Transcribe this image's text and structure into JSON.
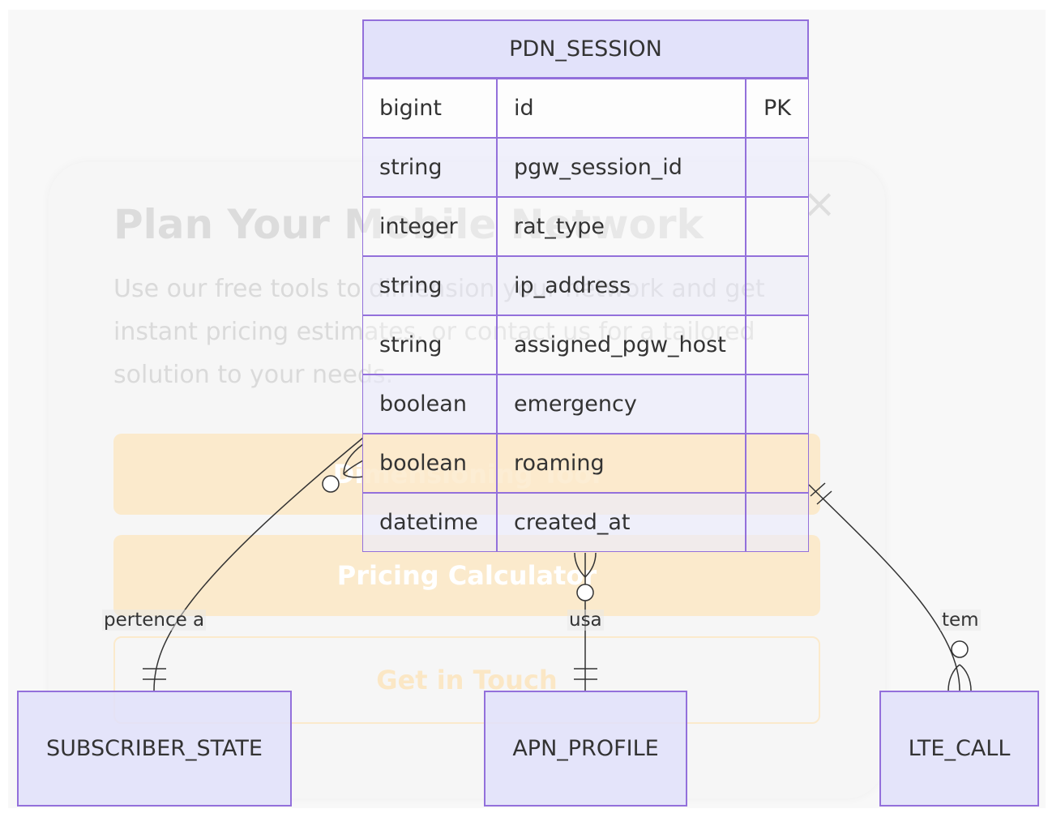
{
  "modal": {
    "title": "Plan Your Mobile Network",
    "close_glyph": "×",
    "description": "Use our free tools to dimension your network and get instant pricing estimates, or contact us for a tailored solution to your needs.",
    "buttons": {
      "dimensioning": "Dimensioning Tool",
      "pricing": "Pricing Calculator",
      "contact": "Get in Touch"
    }
  },
  "entities": {
    "pdn_session": {
      "name": "PDN_SESSION",
      "attributes": [
        {
          "type": "bigint",
          "name": "id",
          "key": "PK"
        },
        {
          "type": "string",
          "name": "pgw_session_id",
          "key": ""
        },
        {
          "type": "integer",
          "name": "rat_type",
          "key": ""
        },
        {
          "type": "string",
          "name": "ip_address",
          "key": ""
        },
        {
          "type": "string",
          "name": "assigned_pgw_host",
          "key": ""
        },
        {
          "type": "boolean",
          "name": "emergency",
          "key": ""
        },
        {
          "type": "boolean",
          "name": "roaming",
          "key": ""
        },
        {
          "type": "datetime",
          "name": "created_at",
          "key": ""
        }
      ]
    },
    "subscriber_state": {
      "name": "SUBSCRIBER_STATE"
    },
    "apn_profile": {
      "name": "APN_PROFILE"
    },
    "lte_call": {
      "name": "LTE_CALL"
    }
  },
  "relationships": [
    {
      "from": "SUBSCRIBER_STATE",
      "to": "PDN_SESSION",
      "label": "pertence a",
      "from_card": "exactly-one",
      "to_card": "zero-or-many"
    },
    {
      "from": "APN_PROFILE",
      "to": "PDN_SESSION",
      "label": "usa",
      "from_card": "exactly-one",
      "to_card": "zero-or-many"
    },
    {
      "from": "PDN_SESSION",
      "to": "LTE_CALL",
      "label": "tem",
      "from_card": "exactly-one",
      "to_card": "zero-or-many"
    }
  ],
  "colors": {
    "entity_border": "#9370db",
    "entity_fill": "#e0e0fa",
    "line": "#333333",
    "modal_button": "#fbeacc"
  }
}
